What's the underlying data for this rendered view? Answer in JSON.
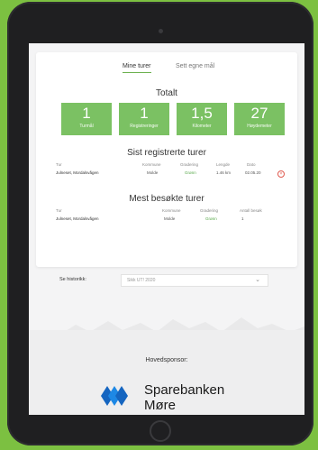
{
  "tabs": [
    {
      "label": "Mine turer",
      "active": true
    },
    {
      "label": "Sett egne mål",
      "active": false
    }
  ],
  "totals": {
    "title": "Totalt",
    "stats": [
      {
        "value": "1",
        "label": "Turmål"
      },
      {
        "value": "1",
        "label": "Registreringer"
      },
      {
        "value": "1,5",
        "label": "Kilometer"
      },
      {
        "value": "27",
        "label": "Høydemeter"
      }
    ]
  },
  "recent": {
    "title": "Sist registrerte turer",
    "headers": {
      "tur": "Tur",
      "kommune": "Kommune",
      "gradering": "Gradering",
      "lengde": "Lengde",
      "dato": "Dato"
    },
    "rows": [
      {
        "tur": "Julneset, Mordalsvågen",
        "kommune": "Molde",
        "gradering": "Grønn",
        "lengde": "1.46 km",
        "dato": "02.05.20"
      }
    ]
  },
  "visited": {
    "title": "Mest besøkte turer",
    "headers": {
      "tur": "Tur",
      "kommune": "Kommune",
      "gradering": "Gradering",
      "antall": "Antall besøk"
    },
    "rows": [
      {
        "tur": "Julneset, Mordalsvågen",
        "kommune": "Molde",
        "gradering": "Grønn",
        "antall": "1"
      }
    ]
  },
  "history": {
    "label": "Se historikk:",
    "selected": "Sikk UT! 2020"
  },
  "sponsor": {
    "label": "Hovedsponsor:",
    "name_line1": "Sparebanken",
    "name_line2": "Møre"
  },
  "colors": {
    "background": "#7cc041",
    "stat_tile": "#7bc163",
    "accent_green": "#58a84a",
    "delete_red": "#e05a4f",
    "logo_blue": "#1565c0"
  }
}
